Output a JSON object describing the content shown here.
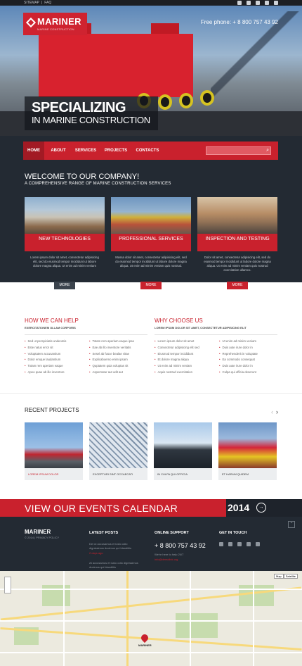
{
  "topbar": {
    "links": [
      "SITEMAP",
      "|",
      "FAQ"
    ],
    "social_icons": [
      "facebook-icon",
      "google-plus-icon",
      "rss-icon",
      "pinterest-icon",
      "linkedin-icon"
    ]
  },
  "header": {
    "logo_text": "MARINER",
    "logo_sub": "MARINE CONSTRUCTION",
    "phone": "Free phone: + 8 800 757 43 92"
  },
  "hero": {
    "line1": "SPECIALIZING",
    "line2": "IN MARINE CONSTRUCTION"
  },
  "nav": {
    "items": [
      "HOME",
      "ABOUT",
      "SERVICES",
      "PROJECTS",
      "CONTACTS"
    ],
    "active": "HOME",
    "search_placeholder": ""
  },
  "welcome": {
    "title": "WELCOME TO OUR COMPANY!",
    "subtitle": "A COMPREHENSIVE RANGE OF MARINE CONSTRUCTION SERVICES"
  },
  "services": [
    {
      "title": "NEW TECHNOLOGIES",
      "text": "Lorem ipsum dolor sit amet, consectetur adipisicing elit, sed do eiusmod tempor incididunt ut labore dolore magna aliqua. Ut enim ad minim veniam",
      "more": "MORE"
    },
    {
      "title": "Professional services",
      "text": "Massa dolor sit amet, consectetur adipisicing elit, sed do eiusmod tempor incididunt ut labore dolore magna aliqua. Ut enim ad minim veniam quis nostrud.",
      "more": "MORE"
    },
    {
      "title": "Inspection and testing",
      "text": "Dolor sit amet, consectetur adipisicing elit, sed do eiusmod tempor incididunt ut labore dolore magna aliqua. Ut enim ad minim veniam quis nostrud exercitation ullamco.",
      "more": "MORE"
    }
  ],
  "help": {
    "title": "HOW WE CAN HELP",
    "subtitle": "EXERCITATIONEM ULLAM CORPORIS",
    "col1": [
      "Sed ut perspiciatis undeomis",
      "Este natus error sit",
      "Voluptatem accusantium",
      "Dolor emque laudantium",
      "Totam rem aperiam eaque",
      "Apeo quae ab illo inventore"
    ],
    "col2": [
      "Totam rem aperiam eaque ipsa",
      "Eae ab illo inventore veritatis",
      "Sesel ab fusce bealae vitae",
      "Explicaboemo enim ipsam",
      "Quptatem quia voluptas sit",
      "Aspernatur aut odit aut"
    ]
  },
  "why": {
    "title": "WHY CHOOSE US",
    "subtitle": "LOREM IPSUM DOLOR SIT AMET, CONSECTETUR ADIPISICING ELIT",
    "col1": [
      "Lorem ipsum dolor sit amet",
      "Consectetur adipisicing elit sed",
      "Eiusmod tempor incididunt",
      "Et dolore magna aliqua",
      "Ut enim ad minim veniam",
      "Aquis nostrud exercitation"
    ],
    "col2": [
      "Ut enim ad minim veniam",
      "Duis aute irure dolor in",
      "Reprehenderit in voluptate",
      "Ea commodo consequat",
      "Duis aute irure dolor in",
      "Culpa qui officia deserunt"
    ]
  },
  "recent": {
    "title": "RECENT PROJECTS",
    "projects": [
      {
        "caption": "LOREM IPSUM DOLOR",
        "highlight": true
      },
      {
        "caption": "EXCEPTURI SINT OCCAECATI",
        "highlight": false
      },
      {
        "caption": "IN CULPA QUI OFFICIA",
        "highlight": false
      },
      {
        "caption": "ET HARUM QUIDEM",
        "highlight": false
      }
    ]
  },
  "events": {
    "title": "VIEW OUR EVENTS CALENDAR",
    "year": "2014"
  },
  "footer": {
    "brand": "MARINER",
    "copyright": "© 2014 | PRIVACY POLICY",
    "latest_posts": {
      "title": "LATEST POSTS",
      "posts": [
        {
          "text": "Dei ut accusamus et iusto odio dignissimos ducimus qui blanditiis",
          "date": "2 days ago"
        },
        {
          "text": "At accusamus et iusto odio dignissimos ducimus qui blanditiis",
          "date": "2 days ago"
        }
      ]
    },
    "support": {
      "title": "ONLINE SUPPORT",
      "phone": "+ 8 800 757 43 92",
      "line": "We're here to help 24/7",
      "email": "info@demolink.org"
    },
    "touch": {
      "title": "GET IN TOUCH"
    }
  },
  "map": {
    "pin_label": "MARINER",
    "controls": [
      "Map",
      "Satellite"
    ]
  },
  "colors": {
    "accent": "#c9212d",
    "dark": "#232a33"
  }
}
